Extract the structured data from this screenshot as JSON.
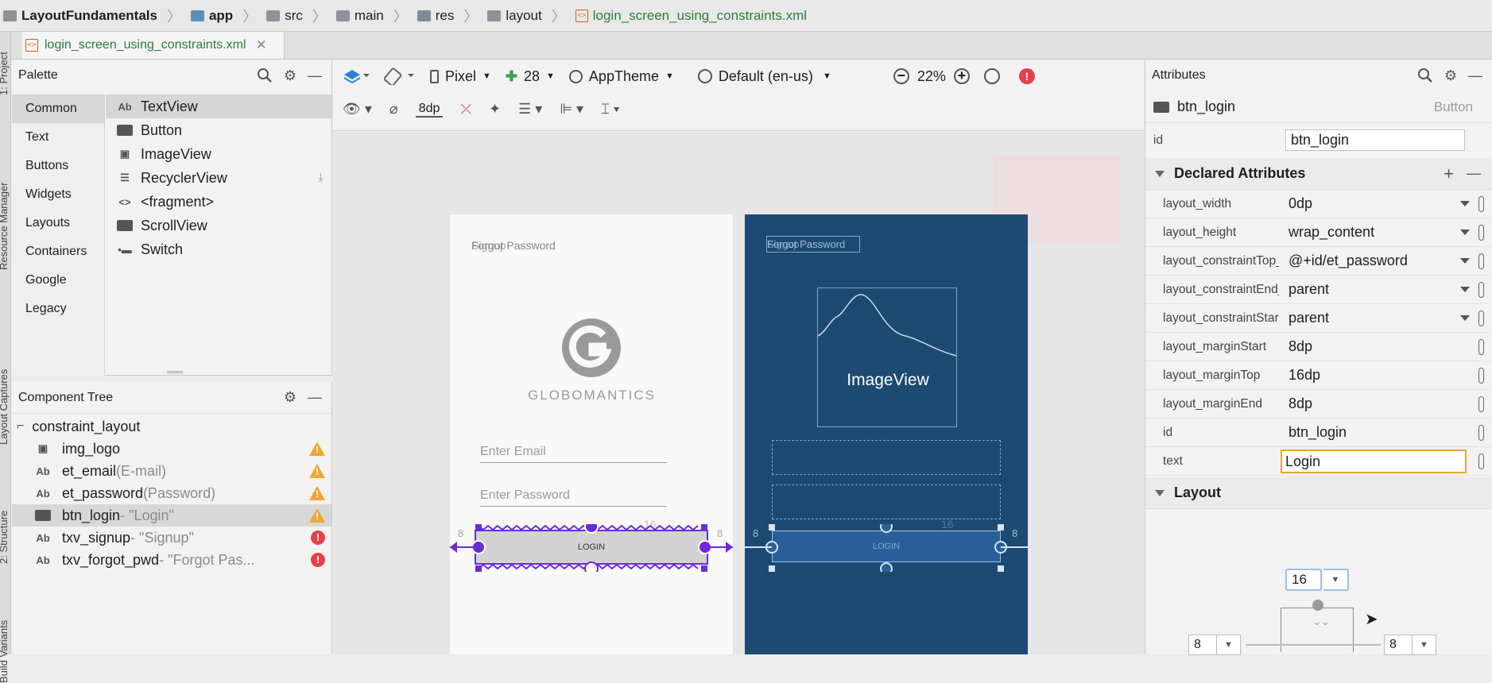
{
  "breadcrumb": {
    "project": "LayoutFundamentals",
    "module": "app",
    "p1": "src",
    "p2": "main",
    "p3": "res",
    "p4": "layout",
    "file": "login_screen_using_constraints.xml"
  },
  "editor_tab": {
    "label": "login_screen_using_constraints.xml"
  },
  "tool_stripe": {
    "project": "1: Project",
    "resource": "Resource Manager",
    "captures": "Layout Captures",
    "structure": "2: Structure",
    "build": "Build Variants"
  },
  "palette": {
    "title": "Palette",
    "categories": [
      "Common",
      "Text",
      "Buttons",
      "Widgets",
      "Layouts",
      "Containers",
      "Google",
      "Legacy"
    ],
    "items": [
      {
        "icon": "Ab",
        "label": "TextView"
      },
      {
        "icon": "btn",
        "label": "Button"
      },
      {
        "icon": "img",
        "label": "ImageView"
      },
      {
        "icon": "list",
        "label": "RecyclerView"
      },
      {
        "icon": "<>",
        "label": "<fragment>"
      },
      {
        "icon": "scroll",
        "label": "ScrollView"
      },
      {
        "icon": "switch",
        "label": "Switch"
      }
    ]
  },
  "tree": {
    "title": "Component Tree",
    "root": "constraint_layout",
    "rows": [
      {
        "icon": "img",
        "name": "img_logo",
        "sub": "",
        "status": "warning"
      },
      {
        "icon": "Ab",
        "name": "et_email",
        "sub": "(E-mail)",
        "status": "warning"
      },
      {
        "icon": "Ab",
        "name": "et_password",
        "sub": "(Password)",
        "status": "warning"
      },
      {
        "icon": "btn",
        "name": "btn_login",
        "sub": "- \"Login\"",
        "status": "warning"
      },
      {
        "icon": "Ab",
        "name": "txv_signup",
        "sub": "- \"Signup\"",
        "status": "error"
      },
      {
        "icon": "Ab",
        "name": "txv_forgot_pwd",
        "sub": "- \"Forgot Pas...",
        "status": "error"
      }
    ]
  },
  "toolbar": {
    "device": "Pixel",
    "api": "28",
    "theme": "AppTheme",
    "locale": "Default (en-us)",
    "zoom": "22%",
    "margin": "8dp"
  },
  "design": {
    "overlap_text": "Signup",
    "forgot": "Forgot Password",
    "logo_word": "GLOBOMANTICS",
    "email_hint": "Enter Email",
    "password_hint": "Enter Password",
    "login": "LOGIN",
    "margin_left": "8",
    "margin_right": "8",
    "top_margin": "16"
  },
  "blueprint": {
    "forgot": "Forgot Password",
    "overlap_text": "Signup",
    "imageview": "ImageView",
    "login": "LOGIN",
    "margin_left": "8",
    "margin_right": "8",
    "top_margin": "16"
  },
  "attributes": {
    "title": "Attributes",
    "component": "btn_login",
    "component_type": "Button",
    "id_label": "id",
    "id_value": "btn_login",
    "declared_title": "Declared Attributes",
    "declared": [
      {
        "name": "layout_width",
        "value": "0dp",
        "dropdown": true
      },
      {
        "name": "layout_height",
        "value": "wrap_content",
        "dropdown": true
      },
      {
        "name": "layout_constraintTop_toBottomOf",
        "value": "@+id/et_password",
        "dropdown": true
      },
      {
        "name": "layout_constraintEnd_toEndOf",
        "value": "parent",
        "dropdown": true
      },
      {
        "name": "layout_constraintStart_toStartOf",
        "value": "parent",
        "dropdown": true
      },
      {
        "name": "layout_marginStart",
        "value": "8dp",
        "dropdown": false
      },
      {
        "name": "layout_marginTop",
        "value": "16dp",
        "dropdown": false
      },
      {
        "name": "layout_marginEnd",
        "value": "8dp",
        "dropdown": false
      },
      {
        "name": "id",
        "value": "btn_login",
        "dropdown": false
      },
      {
        "name": "text",
        "value": "Login",
        "dropdown": false,
        "editing": true
      }
    ],
    "layout_title": "Layout",
    "layout_top": "16",
    "layout_start": "8",
    "layout_end": "8"
  }
}
